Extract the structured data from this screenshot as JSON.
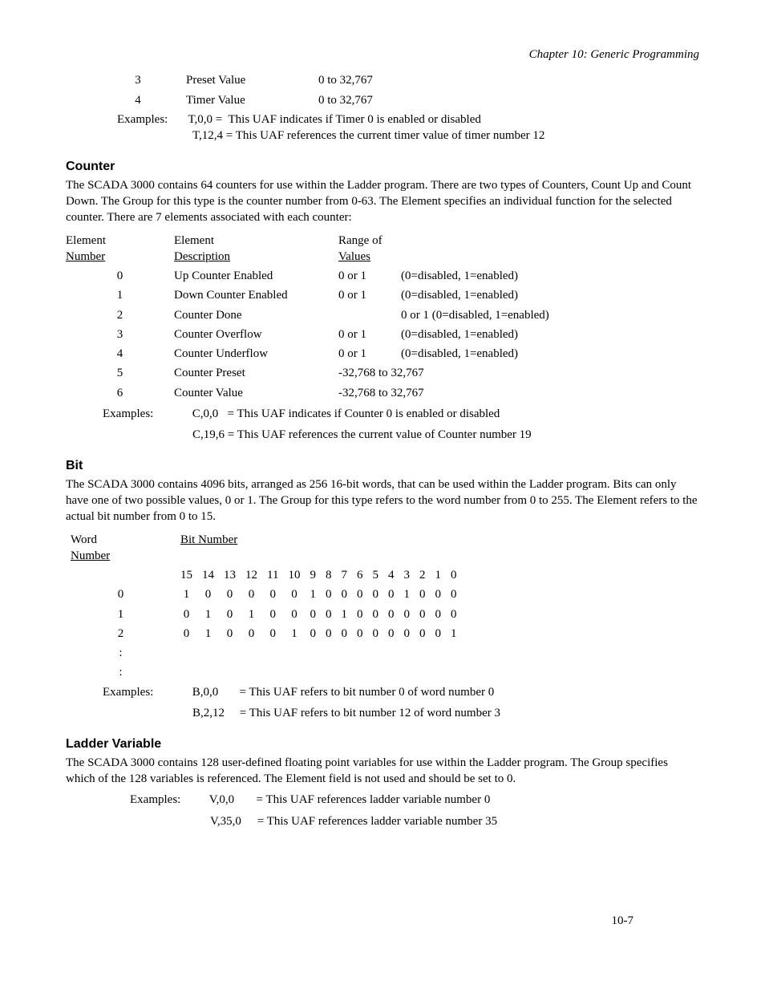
{
  "header": "Chapter 10: Generic Programming",
  "timerRows": [
    {
      "num": "3",
      "desc": "Preset Value",
      "range": "0 to 32,767"
    },
    {
      "num": "4",
      "desc": "Timer Value",
      "range": "0 to 32,767"
    }
  ],
  "timerExamplesLabel": "Examples:",
  "timerEx1a": "T,0,0 =",
  "timerEx1b": "This UAF indicates if Timer 0 is enabled or disabled",
  "timerEx2": "T,12,4 = This UAF references the current timer value of timer number 12",
  "counter": {
    "title": "Counter",
    "para": "The SCADA 3000 contains 64 counters for use within the Ladder program. There are two types of Counters, Count Up and Count Down. The Group for this type is the counter number from 0-63. The Element specifies an individual function for the selected counter.  There are 7 elements associated with each counter:",
    "head": {
      "c1a": "Element",
      "c1b": "Number",
      "c2a": "Element",
      "c2b": "Description",
      "c3a": "Range of",
      "c3b": "Values"
    },
    "rows": [
      {
        "n": "0",
        "d": "Up Counter Enabled",
        "r": "0 or 1",
        "note": "(0=disabled, 1=enabled)"
      },
      {
        "n": "1",
        "d": "Down Counter Enabled",
        "r": "0 or 1",
        "note": "(0=disabled, 1=enabled)"
      },
      {
        "n": "2",
        "d": "Counter Done",
        "r": "",
        "note": "0 or 1   (0=disabled, 1=enabled)"
      },
      {
        "n": "3",
        "d": "Counter Overflow",
        "r": "0 or 1",
        "note": "(0=disabled, 1=enabled)"
      },
      {
        "n": "4",
        "d": "Counter Underflow",
        "r": "0 or 1",
        "note": "(0=disabled, 1=enabled)"
      },
      {
        "n": "5",
        "d": "Counter Preset",
        "r": "-32,768 to 32,767",
        "note": ""
      },
      {
        "n": "6",
        "d": "Counter Value",
        "r": "-32,768 to 32,767",
        "note": ""
      }
    ],
    "examplesLabel": "Examples:",
    "ex1a": "C,0,0",
    "ex1b": "=  This UAF indicates if Counter 0 is enabled or disabled",
    "ex2": "C,19,6 =  This UAF references the current value of Counter number 19"
  },
  "bit": {
    "title": "Bit",
    "para": "The SCADA 3000 contains 4096 bits, arranged as 256 16-bit words, that can be used within the Ladder program. Bits can only have one of two possible values, 0 or 1. The Group for this type refers to the word number from 0 to 255. The Element refers to the actual bit number from 0 to 15.",
    "wordLabelA": "Word",
    "wordLabelB": "Number",
    "bitLabel": "Bit Number",
    "cols": [
      "15",
      "14",
      "13",
      "12",
      "11",
      "10",
      "9",
      "8",
      "7",
      "6",
      "5",
      "4",
      "3",
      "2",
      "1",
      "0"
    ],
    "rows": [
      {
        "w": "0",
        "b": [
          "1",
          "0",
          "0",
          "0",
          "0",
          "0",
          "1",
          "0",
          "0",
          "0",
          "0",
          "0",
          "1",
          "0",
          "0",
          "0"
        ]
      },
      {
        "w": "1",
        "b": [
          "0",
          "1",
          "0",
          "1",
          "0",
          "0",
          "0",
          "0",
          "1",
          "0",
          "0",
          "0",
          "0",
          "0",
          "0",
          "0"
        ]
      },
      {
        "w": "2",
        "b": [
          "0",
          "1",
          "0",
          "0",
          "0",
          "1",
          "0",
          "0",
          "0",
          "0",
          "0",
          "0",
          "0",
          "0",
          "0",
          "1"
        ]
      }
    ],
    "dots": ":",
    "examplesLabel": "Examples:",
    "ex1a": "B,0,0",
    "ex1b": "=   This UAF refers to bit number 0 of word number 0",
    "ex2a": "B,2,12",
    "ex2b": "=   This UAF refers to bit number 12 of word number 3"
  },
  "ladder": {
    "title": "Ladder Variable",
    "para": "The SCADA 3000 contains 128 user-defined floating point variables for use within the Ladder program.  The Group specifies which of the 128 variables is referenced. The Element field is not used and should be set to 0.",
    "examplesLabel": "Examples:",
    "ex1a": "V,0,0",
    "ex1b": "=  This UAF references ladder variable number 0",
    "ex2a": "V,35,0",
    "ex2b": "=  This UAF references ladder variable number 35"
  },
  "pageNum": "10-7"
}
